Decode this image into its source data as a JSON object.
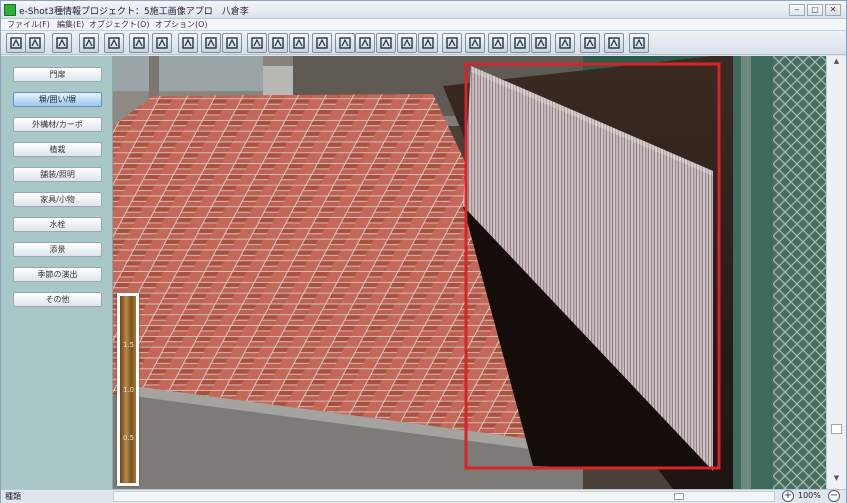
{
  "window": {
    "title": "e-Shot3種情報プロジェクト：5施工画像アプロ　八倉李"
  },
  "menu": {
    "items": [
      "ファイル(F)",
      "編集(E)",
      "オブジェクト(O)",
      "オプション(O)"
    ]
  },
  "toolbar": {
    "icons": [
      "open-icon",
      "save-icon",
      "image-icon",
      "check-icon",
      "rotate-icon",
      "trees-icon",
      "tree-add-icon",
      "trees-group-icon",
      "flip-h-auto-icon",
      "flip-v-auto-icon",
      "pointer-icon",
      "move-up-icon",
      "refresh-icon",
      "stamp-icon",
      "text-icon",
      "rect-select-icon",
      "ellipse-select-icon",
      "polygon-select-icon",
      "lasso-icon",
      "freehand-icon",
      "trees-small-icon",
      "cursor-up-icon",
      "arrow-left-icon",
      "arrow-right-icon",
      "cursor-diag-icon",
      "texture-icon",
      "grid-icon",
      "grid-edit-icon"
    ]
  },
  "sidebar": {
    "buttons": [
      {
        "label": "門扉"
      },
      {
        "label": "塀/囲い/塀",
        "active": true
      },
      {
        "label": "外構材/カーポ"
      },
      {
        "label": "植栽"
      },
      {
        "label": "舗装/照明"
      },
      {
        "label": "家具/小物"
      },
      {
        "label": "水栓"
      },
      {
        "label": "添景"
      },
      {
        "label": "季節の演出"
      },
      {
        "label": "その他"
      }
    ]
  },
  "ruler": {
    "labels": [
      "1.5",
      "1.0",
      "0.5"
    ]
  },
  "statusbar": {
    "left_text": "種類",
    "zoom": "100%",
    "zoom_in": "+",
    "zoom_out": "−"
  },
  "colors": {
    "selection": "#d8232a",
    "panel": "#a8c8c8",
    "active_button": "#9fc6ea"
  }
}
